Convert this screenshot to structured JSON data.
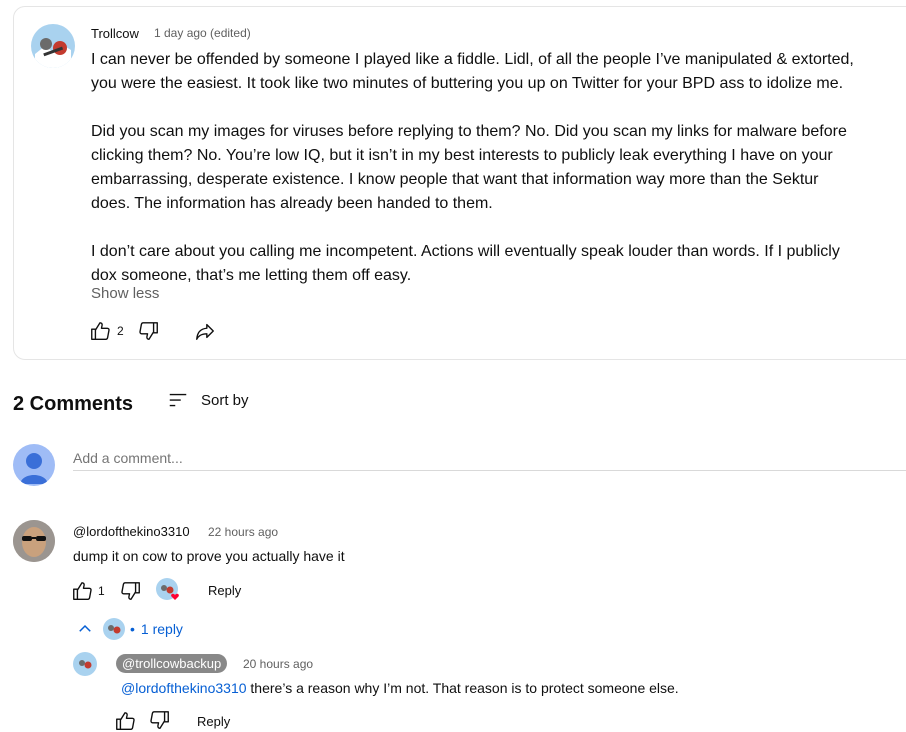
{
  "post": {
    "author": "Trollcow",
    "meta": "1 day ago (edited)",
    "paragraphs": [
      [
        "I can never be offended by someone I played like a fiddle. Lidl, of all the people I’ve manipulated & extorted,",
        "you were the easiest. It took like two minutes of buttering you up on Twitter for your BPD ass to idolize me."
      ],
      [
        "Did you scan my images for viruses before replying to them? No. Did you scan my links for malware before",
        "clicking them? No. You’re low IQ, but it isn’t in my best interests to publicly leak everything I have on your",
        "embarrassing, desperate existence. I know people that want that information way more than the Sektur",
        "does. The information has already been handed to them."
      ],
      [
        "I don’t care about you calling me incompetent. Actions will eventually speak louder than words. If I publicly",
        "dox someone, that’s me letting them off easy."
      ]
    ],
    "show_less": "Show less",
    "likes": "2"
  },
  "comments_header": {
    "count_label": "2 Comments",
    "sort_label": "Sort by"
  },
  "add_comment": {
    "placeholder": "Add a comment..."
  },
  "comment1": {
    "author": "@lordofthekino3310",
    "time": "22 hours ago",
    "text": "dump it on cow to prove you actually have it",
    "likes": "1",
    "reply_label": "Reply",
    "replies_toggle": "1 reply"
  },
  "reply1": {
    "author": "@trollcowbackup",
    "time": "20 hours ago",
    "mention": "@lordofthekino3310",
    "text": " there’s a reason why I’m not. That reason is to protect someone else.",
    "reply_label": "Reply"
  },
  "colors": {
    "link_blue": "#065fd4",
    "heart_red": "#ff0033",
    "badge_grey": "#888888"
  }
}
